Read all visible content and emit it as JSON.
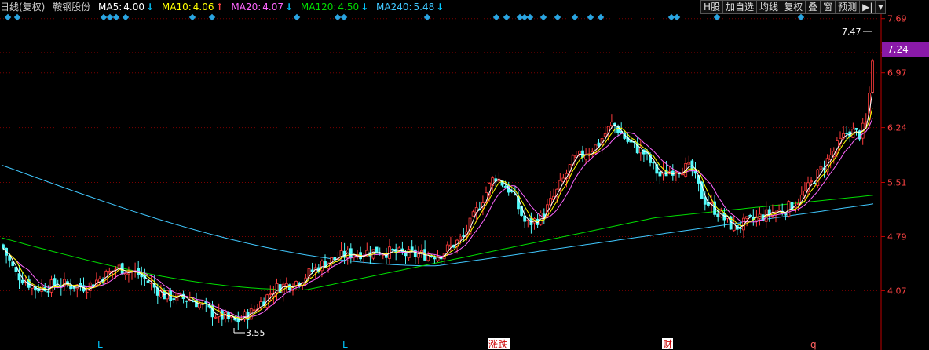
{
  "header": {
    "period": "日线(复权)",
    "stock_name": "鞍钢股份",
    "ma5": {
      "label": "MA5:",
      "value": "4.00",
      "dir": "↓",
      "color": "#ffffff",
      "arrow_color": "#00c8ff"
    },
    "ma10": {
      "label": "MA10:",
      "value": "4.06",
      "dir": "↑",
      "color": "#ffff00",
      "arrow_color": "#ff4040"
    },
    "ma20": {
      "label": "MA20:",
      "value": "4.07",
      "dir": "↓",
      "color": "#ff66ff",
      "arrow_color": "#00c8ff"
    },
    "ma120": {
      "label": "MA120:",
      "value": "4.50",
      "dir": "↓",
      "color": "#00dd00",
      "arrow_color": "#00c8ff"
    },
    "ma240": {
      "label": "MA240:",
      "value": "5.48",
      "dir": "↓",
      "color": "#40c8ff",
      "arrow_color": "#00c8ff"
    }
  },
  "toolbar": {
    "h_share": "H股",
    "add_watch": "加自选",
    "ma_line": "均线",
    "adjust": "复权",
    "overlay": "叠",
    "window": "窗",
    "predict": "预测",
    "collapse_icon": "arrow-right-bar-icon",
    "dropdown_icon": "caret-down-icon"
  },
  "chart_data": {
    "type": "candlestick",
    "y_axis_labels": [
      "7.69",
      "7.24",
      "6.97",
      "6.24",
      "5.51",
      "4.79",
      "4.07"
    ],
    "y_range": [
      3.5,
      7.75
    ],
    "current_price": "7.24",
    "annotations": {
      "high_label": "7.47",
      "low_label": "3.55"
    },
    "bottom_markers": [
      "L",
      "L",
      "涨跌",
      "财",
      "q"
    ],
    "colors": {
      "up": "#ff3c3c",
      "down": "#54fcfc",
      "ma5": "#ffffff",
      "ma10": "#ffff00",
      "ma20": "#ff66ff",
      "ma120": "#00dd00",
      "ma240": "#40c8ff",
      "grid": "#7a0000",
      "axis_text": "#ff4444",
      "price_tag": "#8a1aa8"
    }
  }
}
